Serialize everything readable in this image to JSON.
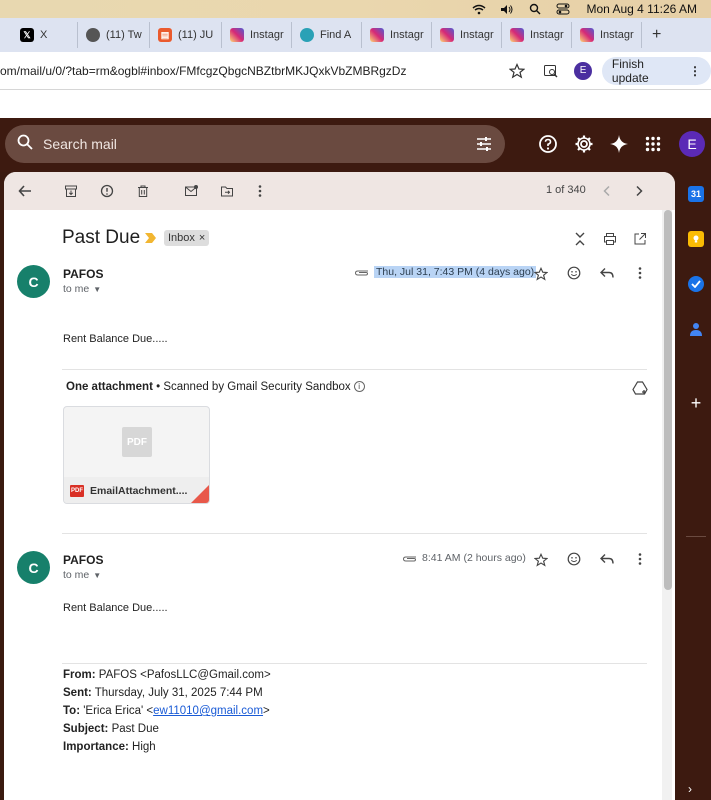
{
  "menubar": {
    "clock": "Mon Aug 4  11:26 AM"
  },
  "tabs": [
    {
      "label": "X",
      "favicon": "x-logo"
    },
    {
      "label": "(11) Tw",
      "favicon": "twitter-avatar"
    },
    {
      "label": "(11) JU",
      "favicon": "ju-logo"
    },
    {
      "label": "Instagr",
      "favicon": "instagram-logo"
    },
    {
      "label": "Find A",
      "favicon": "globe-logo"
    },
    {
      "label": "Instagr",
      "favicon": "instagram-logo"
    },
    {
      "label": "Instagr",
      "favicon": "instagram-logo"
    },
    {
      "label": "Instagr",
      "favicon": "instagram-logo"
    },
    {
      "label": "Instagr",
      "favicon": "instagram-logo"
    }
  ],
  "new_tab": "+",
  "address": {
    "url": "om/mail/u/0/?tab=rm&ogbl#inbox/FMfcgzQbgcNBZtbrMKJQxkVbZMBRgzDz",
    "profile_initial": "E",
    "finish_update": "Finish update"
  },
  "gmail": {
    "search_placeholder": "Search mail",
    "account_initial": "E",
    "pager": "1 of 340",
    "subject": "Past Due",
    "label_chip": "Inbox",
    "messages": [
      {
        "avatar": "C",
        "sender": "PAFOS",
        "to": "to me",
        "date": "Thu, Jul 31, 7:43 PM (4 days ago)",
        "body": "Rent  Balance Due.....",
        "attachment": {
          "header_bold": "One attachment",
          "header_rest": " • Scanned by Gmail Security Sandbox",
          "thumb": "PDF",
          "badge": "PDF",
          "filename": "EmailAttachment...."
        }
      },
      {
        "avatar": "C",
        "sender": "PAFOS",
        "to": "to me",
        "date": "8:41 AM (2 hours ago)",
        "body": "Rent  Balance Due.....",
        "quoted": {
          "from_label": "From:",
          "from_value": " PAFOS <PafosLLC@Gmail.com>",
          "sent_label": "Sent:",
          "sent_value": " Thursday, July 31, 2025 7:44 PM",
          "to_label": "To:",
          "to_value_pre": " 'Erica Erica' <",
          "to_email": "ew11010@gmail.com",
          "to_value_post": ">",
          "subject_label": "Subject:",
          "subject_value": " Past Due",
          "importance_label": "Importance:",
          "importance_value": " High"
        }
      }
    ]
  },
  "colors": {
    "theme_dark": "#3d1a10",
    "search_bg": "#6a4a40",
    "avatar_green": "#17806b",
    "account_purple": "#5b2ab6",
    "selection_blue": "#b9d4f5"
  }
}
